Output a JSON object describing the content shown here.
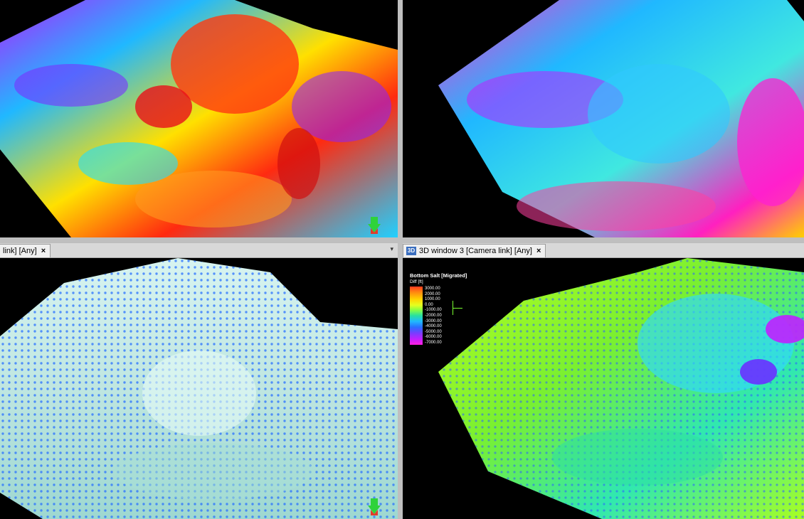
{
  "windows": [
    {
      "id": "top-left",
      "tab_label": null
    },
    {
      "id": "top-right",
      "tab_label": null
    },
    {
      "id": "bottom-left",
      "tab_label": "link] [Any]"
    },
    {
      "id": "bottom-right",
      "tab_label": "3D window 3 [Camera link] [Any]",
      "badge": "3D"
    }
  ],
  "tabs": {
    "bottom_left": {
      "label": "link] [Any]",
      "close": "×"
    },
    "bottom_right": {
      "badge": "3D",
      "label": "3D window 3 [Camera link] [Any]",
      "close": "×"
    }
  },
  "legend": {
    "title": "Bottom Salt [Migrated]",
    "unit": "Diff [ft]",
    "ticks": [
      "3000.00",
      "2000.00",
      "1000.00",
      "0.00",
      "-1000.00",
      "-2000.00",
      "-3000.00",
      "-4000.00",
      "-5000.00",
      "-6000.00",
      "-7000.00"
    ]
  },
  "colors": {
    "background": "#000000",
    "divider": "#bfbfbf",
    "tabbar": "#d8d8d8",
    "nav_arrow_green": "#2fd23a",
    "nav_arrow_red": "#e23b2a"
  }
}
